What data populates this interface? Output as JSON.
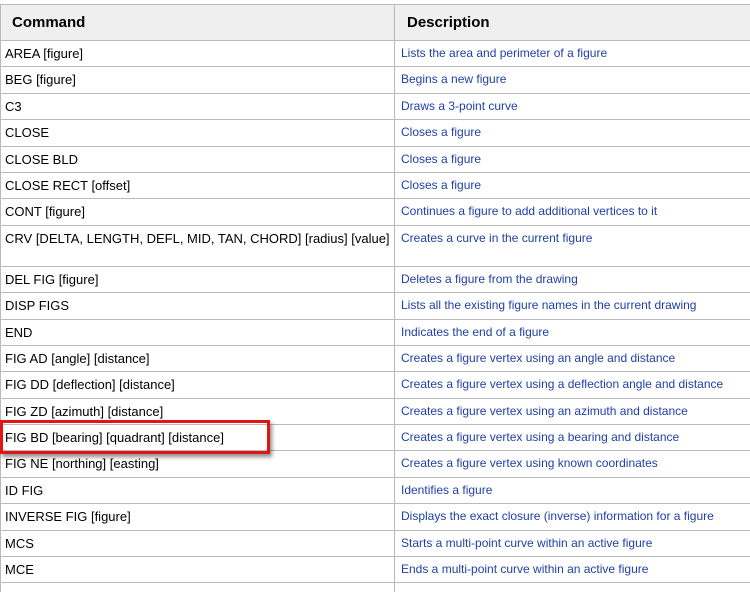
{
  "table": {
    "headers": {
      "command": "Command",
      "description": "Description"
    },
    "rows": [
      {
        "command": "AREA [figure]",
        "description": "Lists the area and perimeter of a figure"
      },
      {
        "command": "BEG [figure]",
        "description": "Begins a new figure"
      },
      {
        "command": "C3",
        "description": "Draws a 3-point curve"
      },
      {
        "command": "CLOSE",
        "description": "Closes a figure"
      },
      {
        "command": "CLOSE BLD",
        "description": "Closes a figure"
      },
      {
        "command": "CLOSE RECT [offset]",
        "description": "Closes a figure"
      },
      {
        "command": "CONT [figure]",
        "description": "Continues a figure to add additional vertices to it"
      },
      {
        "command": "CRV [DELTA, LENGTH, DEFL, MID, TAN, CHORD] [radius] [value]",
        "description": "Creates a curve in the current figure"
      },
      {
        "command": "DEL FIG [figure]",
        "description": "Deletes a figure from the drawing"
      },
      {
        "command": "DISP FIGS",
        "description": "Lists all the existing figure names in the current drawing"
      },
      {
        "command": "END",
        "description": "Indicates the end of a figure"
      },
      {
        "command": "FIG AD [angle] [distance]",
        "description": "Creates a figure vertex using an angle and distance"
      },
      {
        "command": "FIG DD [deflection] [distance]",
        "description": "Creates a figure vertex using a deflection angle and distance"
      },
      {
        "command": "FIG ZD [azimuth] [distance]",
        "description": "Creates a figure vertex using an azimuth and distance"
      },
      {
        "command": "FIG BD [bearing] [quadrant] [distance]",
        "description": "Creates a figure vertex using a bearing and distance"
      },
      {
        "command": "FIG NE [northing] [easting]",
        "description": "Creates a figure vertex using known coordinates"
      },
      {
        "command": "ID FIG",
        "description": "Identifies a figure"
      },
      {
        "command": "INVERSE FIG [figure]",
        "description": "Displays the exact closure (inverse) information for a figure"
      },
      {
        "command": "MCS",
        "description": "Starts a multi-point curve within an active figure"
      },
      {
        "command": "MCE",
        "description": "Ends a multi-point curve within an active figure"
      },
      {
        "command": "",
        "description": ""
      }
    ]
  },
  "highlight": {
    "row_index": 14,
    "color": "#e01515"
  },
  "colors": {
    "header_bg": "#efefef",
    "border": "#b9b9b9",
    "description_text": "#1f3fa6"
  }
}
